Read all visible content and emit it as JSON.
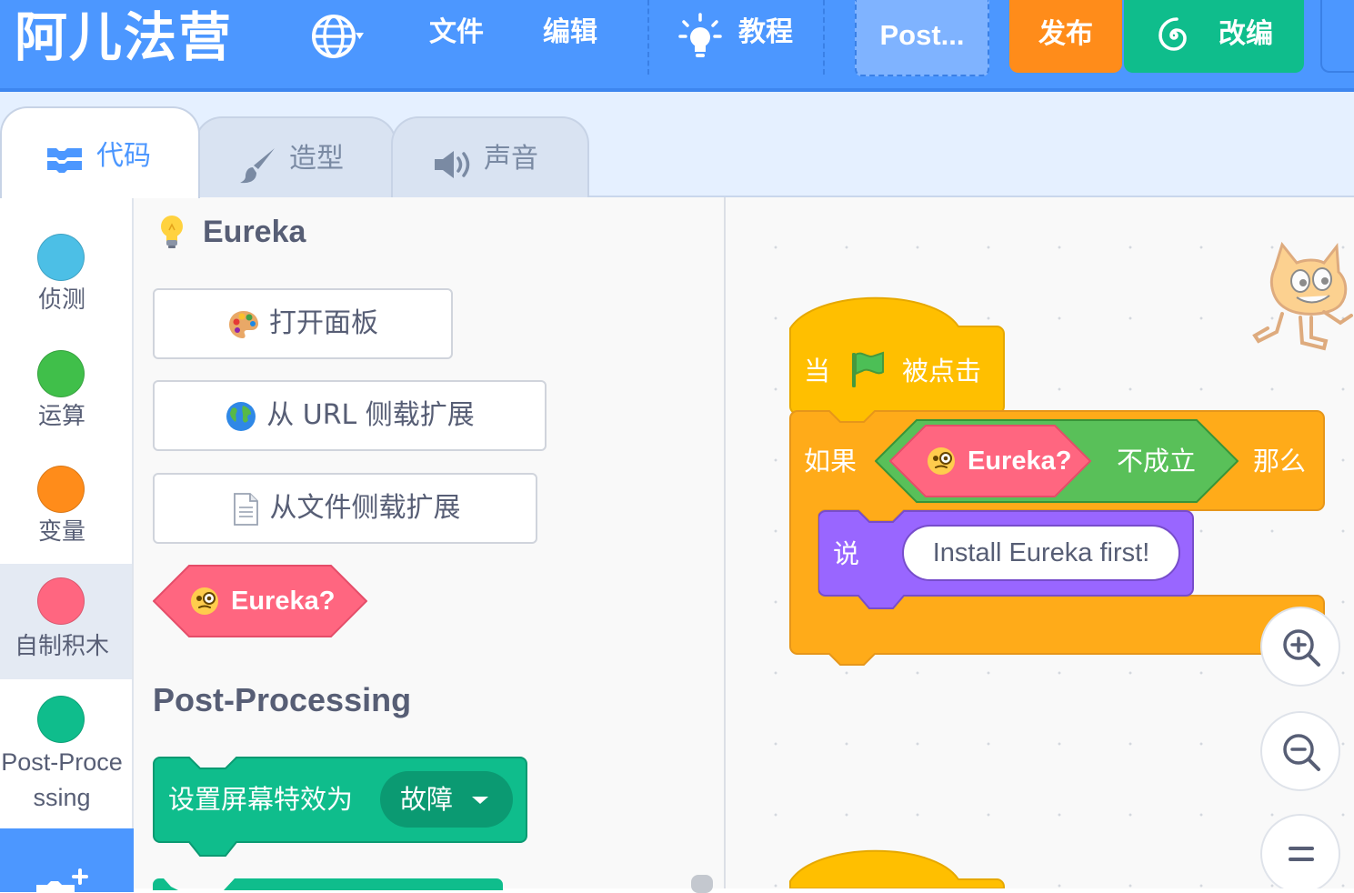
{
  "menubar": {
    "logo": "阿儿法营",
    "file": "文件",
    "edit": "编辑",
    "tutorial": "教程",
    "project_title": "Post...",
    "publish": "发布",
    "remix": "改编"
  },
  "tabs": [
    {
      "label": "代码",
      "icon": "code-icon"
    },
    {
      "label": "造型",
      "icon": "brush-icon"
    },
    {
      "label": "声音",
      "icon": "speaker-icon"
    }
  ],
  "categories": [
    {
      "label": "侦测",
      "color": "#4cbfe6"
    },
    {
      "label": "运算",
      "color": "#40bf4a"
    },
    {
      "label": "变量",
      "color": "#ff8c1a"
    },
    {
      "label": "自制积木",
      "color": "#ff6680"
    },
    {
      "label": "Post-Processing",
      "color": "#0fbd8c"
    }
  ],
  "palette": {
    "eureka_title": "Eureka",
    "open_panel": "打开面板",
    "load_url": "从 URL 侧载扩展",
    "load_file": "从文件侧载扩展",
    "eureka_reporter": "Eureka?",
    "pp_title": "Post-Processing",
    "set_effect": "设置屏幕特效为",
    "effect_value": "故障"
  },
  "script": {
    "when": "当",
    "clicked": "被点击",
    "if": "如果",
    "eureka": "Eureka?",
    "not_true": "不成立",
    "then": "那么",
    "say": "说",
    "say_text": "Install Eureka first!"
  },
  "colors": {
    "menubar": "#4c97ff",
    "events": "#ffbf00",
    "control": "#ffab19",
    "looks": "#9966ff",
    "operators": "#59c059",
    "custom": "#ff6680",
    "postprocessing": "#0fbd8c",
    "publish": "#ff8c1a",
    "remix": "#0fbd8c"
  },
  "icons": [
    "globe-icon",
    "bulb-icon",
    "spiral-icon",
    "palette-icon",
    "earth-icon",
    "file-icon",
    "monocle-face-icon",
    "green-flag-icon",
    "zoom-in-icon",
    "zoom-out-icon",
    "zoom-reset-icon",
    "scratch-cat-sprite",
    "add-extension-icon"
  ]
}
